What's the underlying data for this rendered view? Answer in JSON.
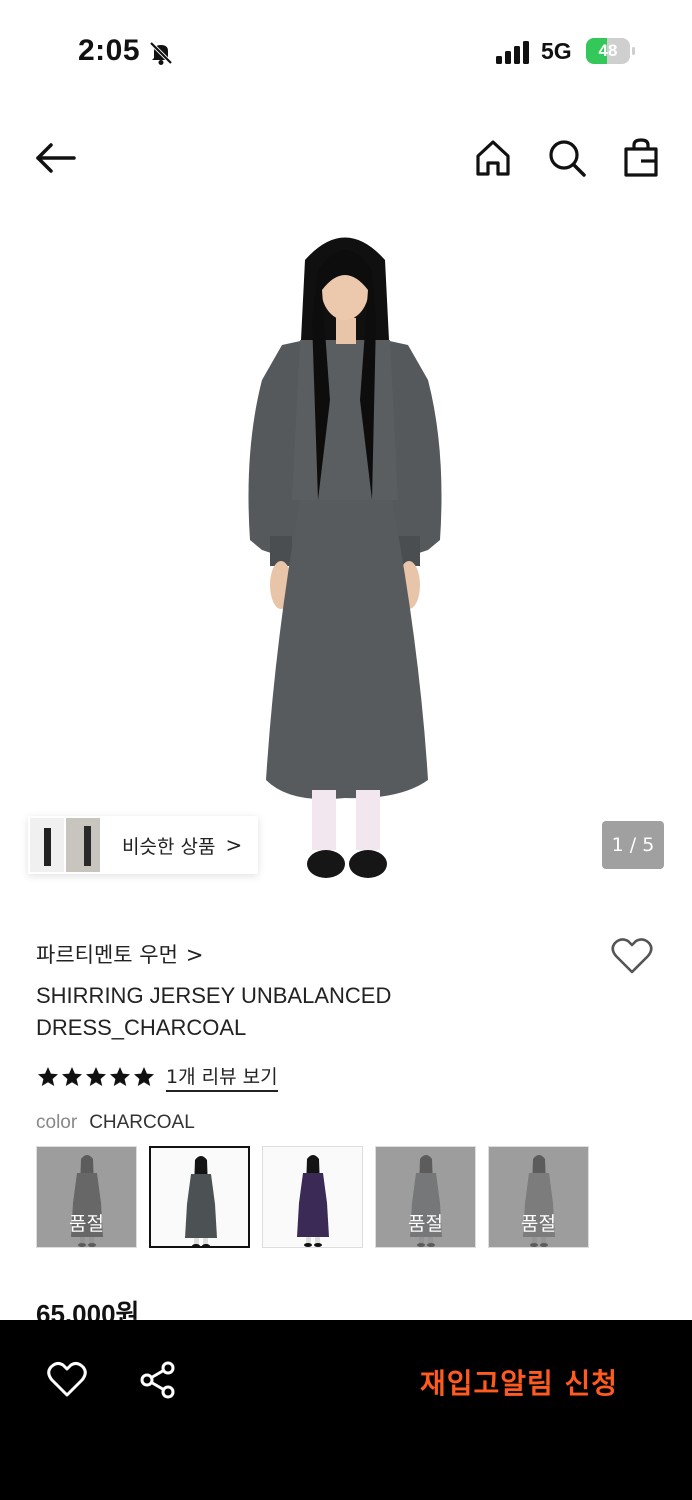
{
  "status_bar": {
    "time": "2:05",
    "network": "5G",
    "battery": "48",
    "battery_level": 0.48
  },
  "nav": {
    "back_icon": "arrow-left-icon",
    "home_icon": "home-icon",
    "search_icon": "search-icon",
    "bag_icon": "shopping-bag-icon"
  },
  "gallery": {
    "counter": "1 / 5",
    "similar_label": "비슷한 상품",
    "similar_chevron": ">"
  },
  "product": {
    "brand": "파르티멘토 우먼",
    "brand_chevron": ">",
    "name": "SHIRRING JERSEY UNBALANCED DRESS_CHARCOAL",
    "rating_stars": 5,
    "review_link": "1개 리뷰 보기",
    "color_label": "color",
    "color_value": "CHARCOAL",
    "swatches": [
      {
        "sold_out": "품절",
        "dress": "#3c3c3c",
        "selected": false
      },
      {
        "sold_out": "",
        "dress": "#4c5254",
        "selected": true
      },
      {
        "sold_out": "",
        "dress": "#3b2a56",
        "selected": false
      },
      {
        "sold_out": "품절",
        "dress": "#6f7577",
        "selected": false
      },
      {
        "sold_out": "품절",
        "dress": "#8a8684",
        "selected": false
      }
    ],
    "price": "65,000원"
  },
  "bottom_bar": {
    "cta_label": "재입고알림 신청",
    "cta_color": "#ff5a1f"
  }
}
